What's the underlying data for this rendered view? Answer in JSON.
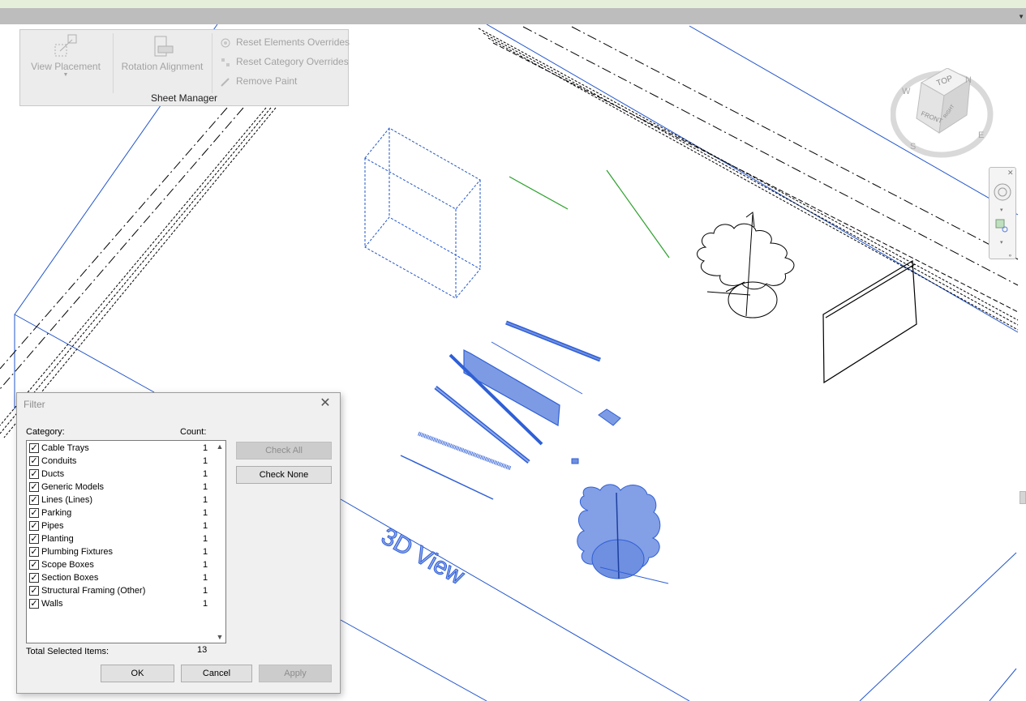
{
  "ribbon": {
    "view_placement_label": "View Placement",
    "rotation_alignment_label": "Rotation Alignment",
    "reset_elements_overrides_label": "Reset Elements Overrides",
    "reset_category_overrides_label": "Reset Category Overrides",
    "remove_paint_label": "Remove Paint",
    "panel_title": "Sheet Manager"
  },
  "viewcube": {
    "top_face": "TOP",
    "front_face": "FRONT",
    "right_face": "RIGHT",
    "compass": [
      "W",
      "N",
      "E",
      "S"
    ]
  },
  "viewport": {
    "view_label": "3D View",
    "colors": {
      "selection": "#2f5fd6",
      "selection_fill": "#6f8fe0",
      "green_line": "#2ca02c",
      "section_box": "#2255cc"
    }
  },
  "filter_dialog": {
    "title": "Filter",
    "category_header": "Category:",
    "count_header": "Count:",
    "categories": [
      {
        "name": "Cable Trays",
        "count": "1",
        "checked": true
      },
      {
        "name": "Conduits",
        "count": "1",
        "checked": true
      },
      {
        "name": "Ducts",
        "count": "1",
        "checked": true
      },
      {
        "name": "Generic Models",
        "count": "1",
        "checked": true
      },
      {
        "name": "Lines (Lines)",
        "count": "1",
        "checked": true
      },
      {
        "name": "Parking",
        "count": "1",
        "checked": true
      },
      {
        "name": "Pipes",
        "count": "1",
        "checked": true
      },
      {
        "name": "Planting",
        "count": "1",
        "checked": true
      },
      {
        "name": "Plumbing Fixtures",
        "count": "1",
        "checked": true
      },
      {
        "name": "Scope Boxes",
        "count": "1",
        "checked": true
      },
      {
        "name": "Section Boxes",
        "count": "1",
        "checked": true
      },
      {
        "name": "Structural Framing (Other)",
        "count": "1",
        "checked": true
      },
      {
        "name": "Walls",
        "count": "1",
        "checked": true
      }
    ],
    "check_all_label": "Check All",
    "check_none_label": "Check None",
    "total_label": "Total Selected Items:",
    "total_value": "13",
    "ok_label": "OK",
    "cancel_label": "Cancel",
    "apply_label": "Apply"
  }
}
